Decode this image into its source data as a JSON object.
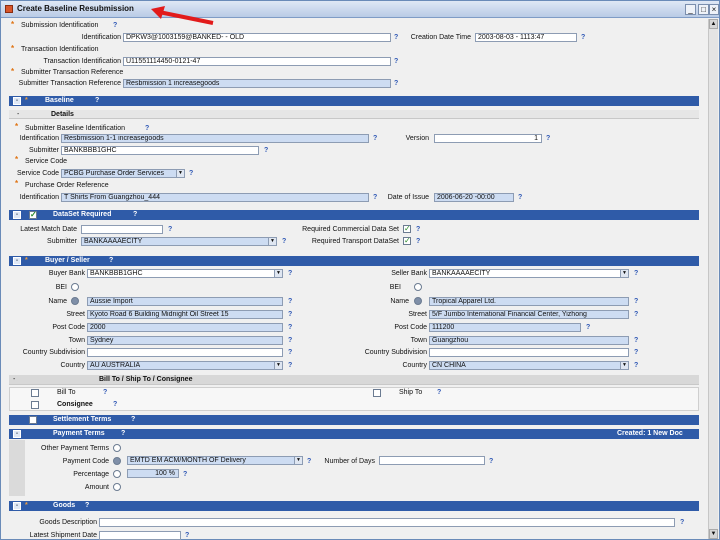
{
  "window": {
    "title": "Create Baseline Resubmission"
  },
  "header": {
    "sub_ident": "Submission Identification",
    "ident_label": "Identification",
    "ident_value": "DPKW3@1003159@BANKED- - OLD",
    "creation_label": "Creation Date Time",
    "creation_value": "2003-08-03 - 1113:47",
    "txn_ident": "Transaction Identification",
    "txn_label": "Transaction Identification",
    "txn_value": "U11551114450-0121-47",
    "sub_txn_ref": "Submitter Transaction Reference",
    "sub_txn_label": "Submitter Transaction Reference",
    "sub_txn_value": "Resbmission 1 increasegoods"
  },
  "baseline": {
    "title": "Baseline",
    "details": "Details",
    "sub_baseline_ident": "Submitter Baseline Identification",
    "ident_label": "Identification",
    "ident_value": "Resbmission 1-1 increasegoods",
    "version_label": "Version",
    "version_value": "1",
    "submitter_label": "Submitter",
    "submitter_value": "BANKBBB1GHC",
    "service_code_title": "Service Code",
    "service_code_label": "Service Code",
    "service_code_value": "PCBG Purchase Order Services",
    "po_ref": "Purchase Order Reference",
    "po_ident_label": "Identification",
    "po_ident_value": "T Shirts From Guangzhou_444",
    "date_issue_label": "Date of Issue",
    "date_issue_value": "2006-06-20 -00:00"
  },
  "dataset": {
    "title": "DataSet Required",
    "match_date_label": "Latest Match Date",
    "submitter_label": "Submitter",
    "submitter_value": "BANKAAAAECITY",
    "req_commercial_label": "Required Commercial Data Set",
    "req_transport_label": "Required Transport DataSet"
  },
  "buyer_seller": {
    "title": "Buyer / Seller",
    "buyer": {
      "bank_label": "Buyer Bank",
      "bank_value": "BANKBBB1GHC",
      "bei_label": "BEI",
      "name_label": "Name",
      "name_value": "Aussie Import",
      "street_label": "Street",
      "street_value": "Kyoto Road 6 Building Midnight Oil Street 15",
      "post_label": "Post Code",
      "post_value": "2000",
      "town_label": "Town",
      "town_value": "Sydney",
      "subdiv_label": "Country Subdivision",
      "country_label": "Country",
      "country_value": "AU AUSTRALIA"
    },
    "seller": {
      "bank_label": "Seller Bank",
      "bank_value": "BANKAAAAECITY",
      "bei_label": "BEI",
      "name_label": "Name",
      "name_value": "Tropical Apparel Ltd.",
      "street_label": "Street",
      "street_value": "5/F Jumbo International Financial Center, Yizhong",
      "post_label": "Post Code",
      "post_value": "111200",
      "town_label": "Town",
      "town_value": "Guangzhou",
      "subdiv_label": "Country Subdivision",
      "country_label": "Country",
      "country_value": "CN CHINA"
    }
  },
  "bill_ship": {
    "title": "Bill To / Ship To / Consignee",
    "bill_to": "Bill To",
    "ship_to": "Ship To",
    "consignee": "Consignee"
  },
  "settlement": {
    "title": "Settlement Terms"
  },
  "payment": {
    "title": "Payment Terms",
    "created": "Created: 1  New Doc",
    "other_label": "Other Payment Terms",
    "code_label": "Payment Code",
    "code_value": "EMTD EM ACM/MONTH OF Delivery",
    "days_label": "Number of Days",
    "pct_label": "Percentage",
    "pct_value": "100 %",
    "amount_label": "Amount"
  },
  "goods": {
    "title": "Goods",
    "desc_label": "Goods Description",
    "shipment_label": "Latest Shipment Date"
  },
  "colors": {
    "section": "#2f5ba8",
    "field": "#cddcf2",
    "accent": "#e07414"
  }
}
